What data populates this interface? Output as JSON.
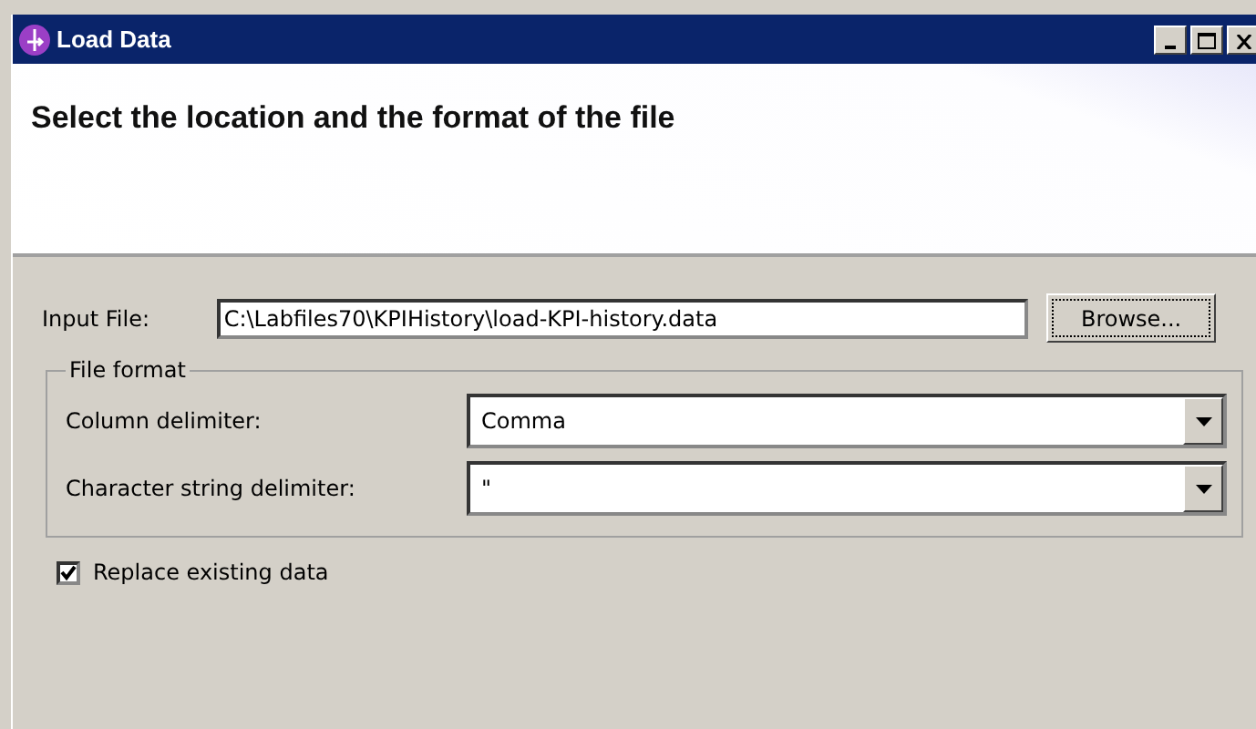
{
  "window": {
    "title": "Load Data"
  },
  "header": {
    "title": "Select the location and the format of the file"
  },
  "input_file": {
    "label": "Input File:",
    "value": "C:\\Labfiles70\\KPIHistory\\load-KPI-history.data",
    "button": "Browse..."
  },
  "file_format": {
    "legend": "File format",
    "fields": [
      {
        "label": "Column delimiter:",
        "value": "Comma"
      },
      {
        "label": "Character string delimiter:",
        "value": "\""
      }
    ]
  },
  "replace_existing": {
    "label": "Replace existing data",
    "checked": true
  }
}
